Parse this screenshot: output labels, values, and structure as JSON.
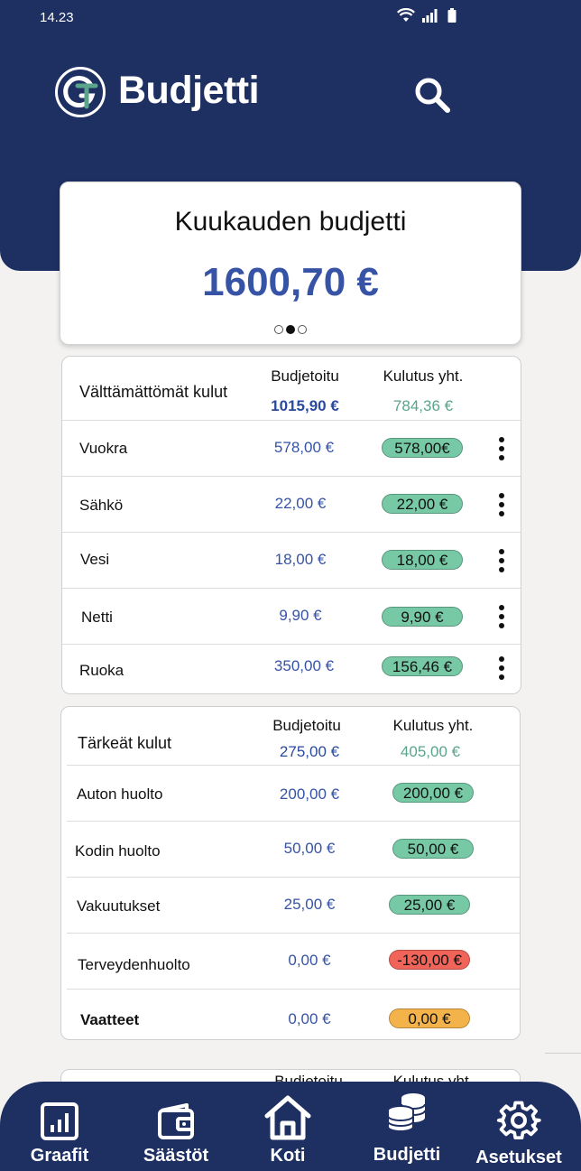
{
  "status_bar": {
    "time": "14.23"
  },
  "header": {
    "title": "Budjetti"
  },
  "budget_card": {
    "title": "Kuukauden budjetti",
    "amount": "1600,70 €"
  },
  "sections": [
    {
      "title": "Välttämättömät kulut",
      "col_budget": "Budjetoitu",
      "col_spent": "Kulutus yht.",
      "total_budget": "1015,90 €",
      "total_spent": "784,36 €",
      "rows": [
        {
          "name": "Vuokra",
          "budget": "578,00 €",
          "spent": "578,00€",
          "status": "green"
        },
        {
          "name": "Sähkö",
          "budget": "22,00 €",
          "spent": "22,00 €",
          "status": "green"
        },
        {
          "name": "Vesi",
          "budget": "18,00 €",
          "spent": "18,00 €",
          "status": "green"
        },
        {
          "name": "Netti",
          "budget": "9,90 €",
          "spent": "9,90 €",
          "status": "green"
        },
        {
          "name": "Ruoka",
          "budget": "350,00 €",
          "spent": "156,46 €",
          "status": "green"
        }
      ]
    },
    {
      "title": "Tärkeät kulut",
      "col_budget": "Budjetoitu",
      "col_spent": "Kulutus yht.",
      "total_budget": "275,00 €",
      "total_spent": "405,00 €",
      "rows": [
        {
          "name": "Auton huolto",
          "budget": "200,00 €",
          "spent": "200,00 €",
          "status": "green"
        },
        {
          "name": "Kodin huolto",
          "budget": "50,00 €",
          "spent": "50,00 €",
          "status": "green"
        },
        {
          "name": "Vakuutukset",
          "budget": "25,00 €",
          "spent": "25,00 €",
          "status": "green"
        },
        {
          "name": "Terveydenhuolto",
          "budget": "0,00 €",
          "spent": "-130,00 €",
          "status": "red"
        },
        {
          "name": "Vaatteet",
          "budget": "0,00 €",
          "spent": "0,00 €",
          "status": "orange"
        }
      ]
    },
    {
      "col_budget": "Budjetoitu",
      "col_spent": "Kulutus yht."
    }
  ],
  "bottom_nav": [
    {
      "label": "Graafit",
      "icon": "chart-icon"
    },
    {
      "label": "Säästöt",
      "icon": "wallet-icon"
    },
    {
      "label": "Koti",
      "icon": "home-icon"
    },
    {
      "label": "Budjetti",
      "icon": "coins-icon"
    },
    {
      "label": "Asetukset",
      "icon": "gear-icon"
    }
  ],
  "colors": {
    "brand": "#1e2f62",
    "accent_blue": "#3653a6",
    "ok_green": "#77c9a6",
    "over_red": "#f0645a",
    "warn_orange": "#f4b24a"
  }
}
